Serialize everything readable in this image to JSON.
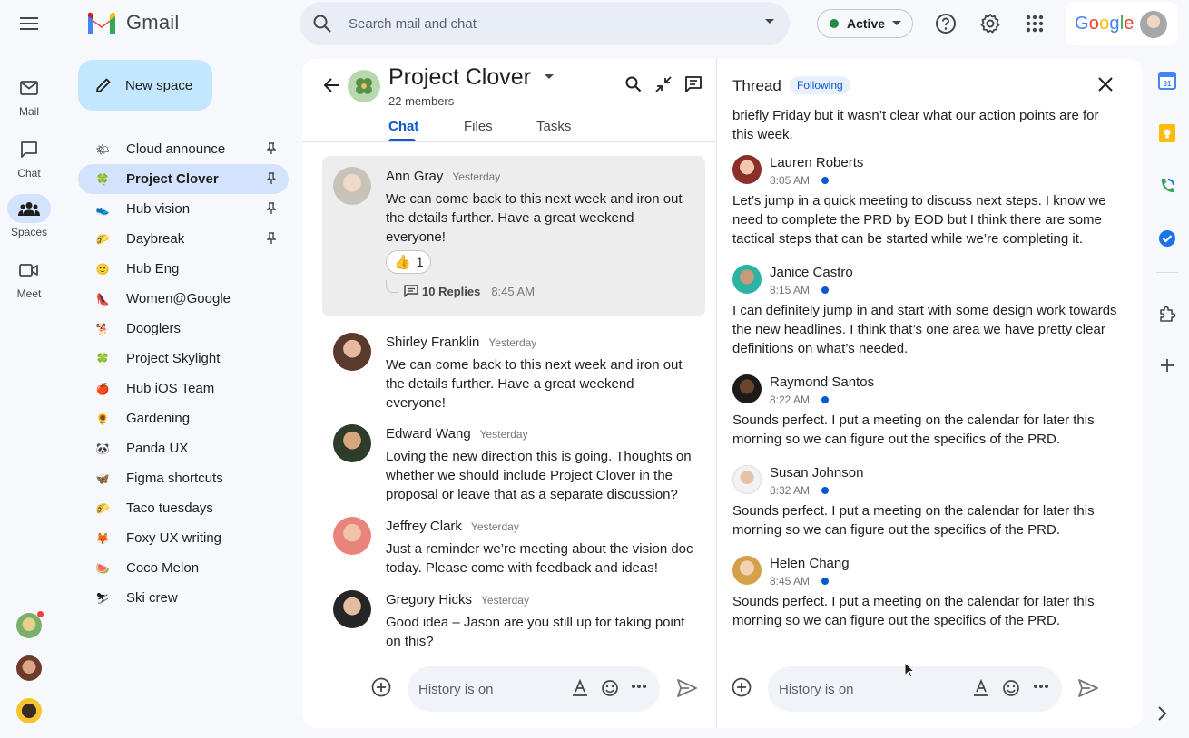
{
  "app": {
    "name": "Gmail",
    "brand_colors": {
      "accent": "#0b57d0",
      "new_space_bg": "#c2e7ff",
      "active_nav": "#d3e3fd"
    }
  },
  "search": {
    "placeholder": "Search mail and chat"
  },
  "status": {
    "label": "Active",
    "color": "#1e8e3e"
  },
  "account": {
    "brand": "Google"
  },
  "rail": {
    "items": [
      {
        "label": "Mail",
        "icon": "mail-icon"
      },
      {
        "label": "Chat",
        "icon": "chat-icon"
      },
      {
        "label": "Spaces",
        "icon": "spaces-icon",
        "active": true
      },
      {
        "label": "Meet",
        "icon": "meet-icon"
      }
    ]
  },
  "new_space": {
    "label": "New space"
  },
  "spaces": [
    {
      "name": "Cloud announce",
      "emoji": "🌤",
      "pinned": true
    },
    {
      "name": "Project Clover",
      "emoji": "🍀",
      "pinned": true,
      "active": true
    },
    {
      "name": "Hub vision",
      "emoji": "👟",
      "pinned": true
    },
    {
      "name": "Daybreak",
      "emoji": "🌮",
      "pinned": true
    },
    {
      "name": "Hub Eng",
      "emoji": "🙂"
    },
    {
      "name": "Women@Google",
      "emoji": "👠"
    },
    {
      "name": "Dooglers",
      "emoji": "🐕"
    },
    {
      "name": "Project Skylight",
      "emoji": "🍀"
    },
    {
      "name": "Hub iOS Team",
      "emoji": "🍎"
    },
    {
      "name": "Gardening",
      "emoji": "🌻"
    },
    {
      "name": "Panda UX",
      "emoji": "🐼"
    },
    {
      "name": "Figma shortcuts",
      "emoji": "🦋"
    },
    {
      "name": "Taco tuesdays",
      "emoji": "🌮"
    },
    {
      "name": "Foxy UX writing",
      "emoji": "🦊"
    },
    {
      "name": "Coco Melon",
      "emoji": "🍉"
    },
    {
      "name": "Ski crew",
      "emoji": "⛷"
    }
  ],
  "space": {
    "title": "Project Clover",
    "members": "22 members",
    "tabs": [
      "Chat",
      "Files",
      "Tasks"
    ],
    "active_tab": "Chat"
  },
  "messages": [
    {
      "author": "Ann Gray",
      "time": "Yesterday",
      "text": "We can come back to this next week and iron out the details further. Have a great weekend everyone!",
      "reaction": {
        "emoji": "👍",
        "count": "1"
      },
      "replies": {
        "count": "10 Replies",
        "time": "8:45 AM"
      },
      "highlight": true
    },
    {
      "author": "Shirley Franklin",
      "time": "Yesterday",
      "text": "We can come back to this next week and iron out the details further. Have a great weekend everyone!"
    },
    {
      "author": "Edward Wang",
      "time": "Yesterday",
      "text": "Loving the new direction this is going. Thoughts on whether we should include Project Clover in the proposal or leave that as a separate discussion?"
    },
    {
      "author": "Jeffrey Clark",
      "time": "Yesterday",
      "text": "Just a reminder we’re meeting about the vision doc today. Please come with feedback and ideas!"
    },
    {
      "author": "Gregory Hicks",
      "time": "Yesterday",
      "text": "Good idea – Jason are you still up for taking point on this?"
    }
  ],
  "composer": {
    "placeholder": "History is on"
  },
  "thread": {
    "title": "Thread",
    "badge": "Following",
    "top_text": "briefly Friday but it wasn’t clear what our action points are for this week.",
    "messages": [
      {
        "author": "Lauren Roberts",
        "time": "8:05 AM",
        "text": "Let’s jump in a quick meeting to discuss next steps. I know we need to complete the PRD by EOD but I think there are some tactical steps that can be started while we’re completing it."
      },
      {
        "author": "Janice Castro",
        "time": "8:15 AM",
        "text": "I can definitely jump in and start with some design work towards the new headlines. I think that’s one area we have pretty clear definitions on what’s needed."
      },
      {
        "author": "Raymond Santos",
        "time": "8:22 AM",
        "text": "Sounds perfect. I put a meeting on the calendar for later this morning so we can figure out the specifics of the PRD."
      },
      {
        "author": "Susan Johnson",
        "time": "8:32 AM",
        "text": "Sounds perfect. I put a meeting on the calendar for later this morning so we can figure out the specifics of the PRD."
      },
      {
        "author": "Helen Chang",
        "time": "8:45 AM",
        "text": "Sounds perfect. I put a meeting on the calendar for later this morning so we can figure out the specifics of the PRD."
      }
    ],
    "composer_placeholder": "History is on"
  },
  "side_panel": {
    "calendar_day": "31"
  }
}
